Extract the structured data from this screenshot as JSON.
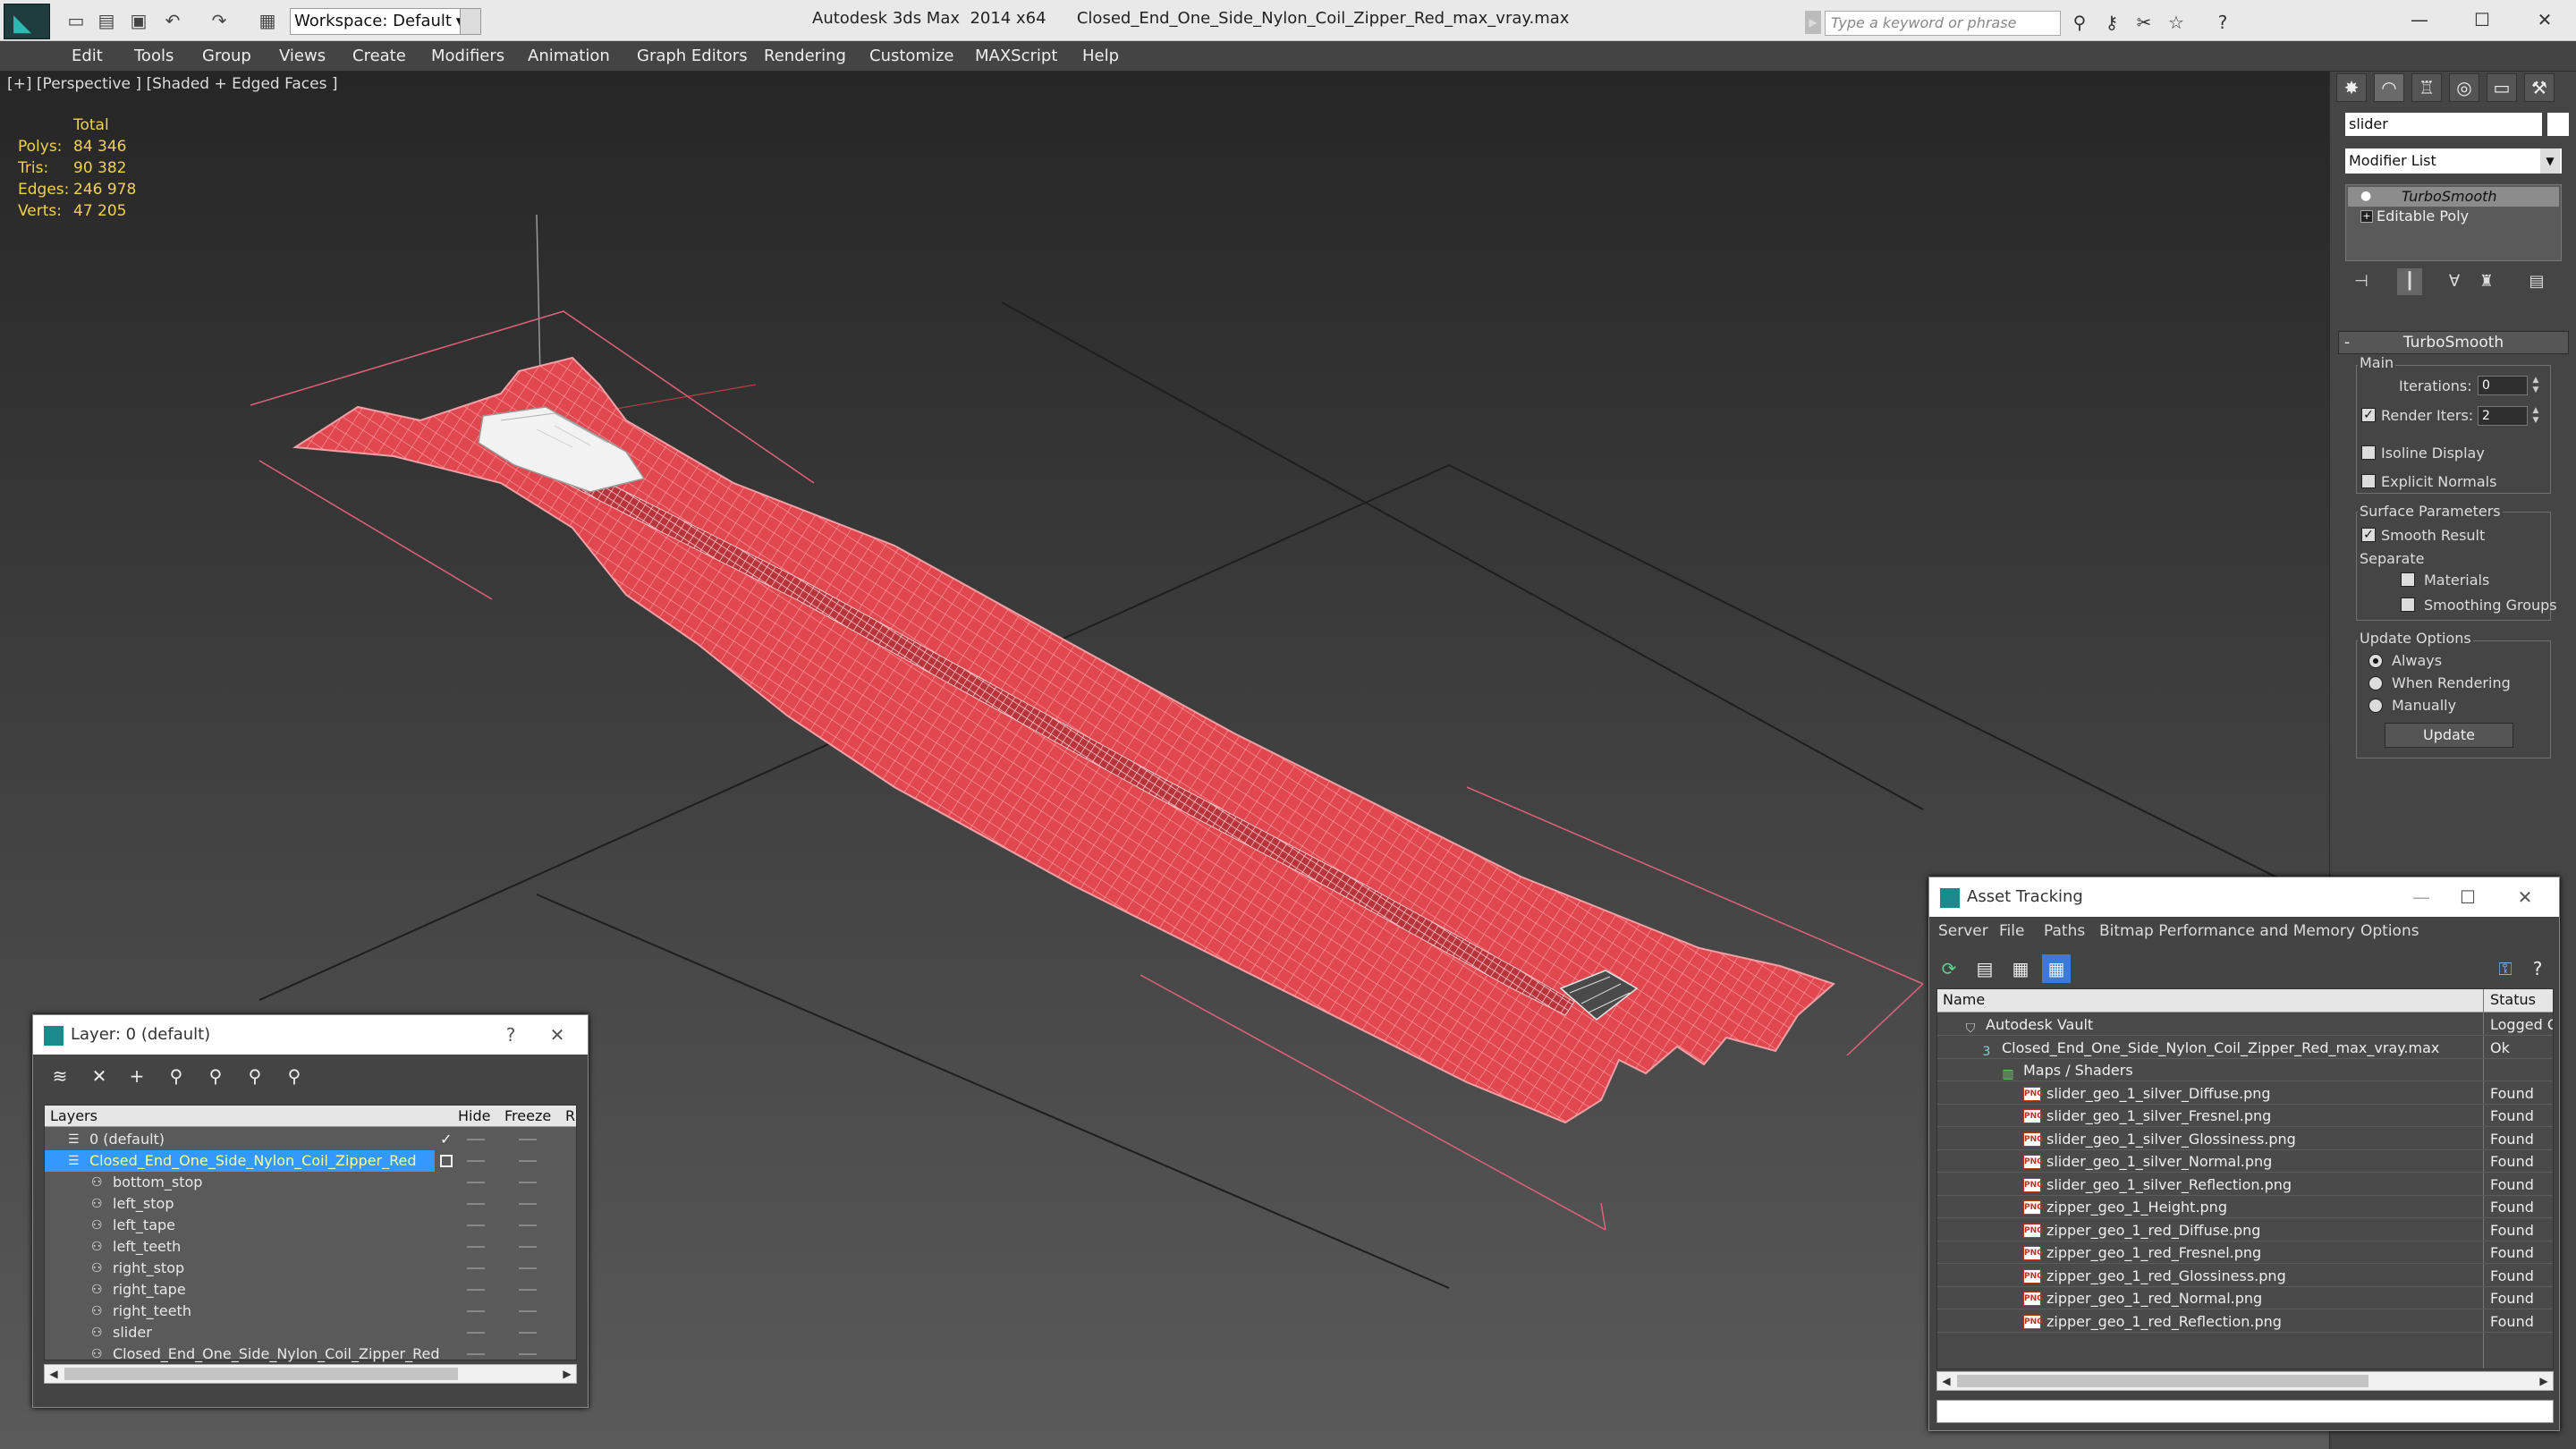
{
  "titlebar": {
    "workspace": "Workspace: Default",
    "app_title": "Autodesk 3ds Max  2014 x64      Closed_End_One_Side_Nylon_Coil_Zipper_Red_max_vray.max",
    "search_placeholder": "Type a keyword or phrase"
  },
  "menu": [
    "Edit",
    "Tools",
    "Group",
    "Views",
    "Create",
    "Modifiers",
    "Animation",
    "Graph Editors",
    "Rendering",
    "Customize",
    "MAXScript",
    "Help"
  ],
  "viewport": {
    "label": "[+] [Perspective ] [Shaded + Edged Faces ]",
    "stats_header": "Total",
    "stats": [
      {
        "label": "Polys:",
        "value": "84 346"
      },
      {
        "label": "Tris:",
        "value": "90 382"
      },
      {
        "label": "Edges:",
        "value": "246 978"
      },
      {
        "label": "Verts:",
        "value": "47 205"
      }
    ]
  },
  "command_panel": {
    "object_name": "slider",
    "modifier_list": "Modifier List",
    "stack": [
      "TurboSmooth",
      "Editable Poly"
    ],
    "rollout_title": "TurboSmooth",
    "main_label": "Main",
    "iterations_label": "Iterations:",
    "iterations_value": "0",
    "render_iters_label": "Render Iters:",
    "render_iters_value": "2",
    "isoline_label": "Isoline Display",
    "explicit_label": "Explicit Normals",
    "surface_label": "Surface Parameters",
    "smooth_label": "Smooth Result",
    "separate_label": "Separate",
    "materials_label": "Materials",
    "smoothing_label": "Smoothing Groups",
    "update_options_label": "Update Options",
    "always_label": "Always",
    "when_rendering_label": "When Rendering",
    "manually_label": "Manually",
    "update_button": "Update"
  },
  "layer_dialog": {
    "title": "Layer: 0 (default)",
    "help": "?",
    "columns": [
      "Layers",
      "Hide",
      "Freeze",
      "R"
    ],
    "rows": [
      {
        "name": "0 (default)",
        "indent": 0
      },
      {
        "name": "Closed_End_One_Side_Nylon_Coil_Zipper_Red",
        "indent": 0
      },
      {
        "name": "bottom_stop",
        "indent": 1
      },
      {
        "name": "left_stop",
        "indent": 1
      },
      {
        "name": "left_tape",
        "indent": 1
      },
      {
        "name": "left_teeth",
        "indent": 1
      },
      {
        "name": "right_stop",
        "indent": 1
      },
      {
        "name": "right_tape",
        "indent": 1
      },
      {
        "name": "right_teeth",
        "indent": 1
      },
      {
        "name": "slider",
        "indent": 1
      },
      {
        "name": "Closed_End_One_Side_Nylon_Coil_Zipper_Red",
        "indent": 1
      }
    ]
  },
  "asset_dialog": {
    "title": "Asset Tracking",
    "menu": [
      "Server",
      "File",
      "Paths",
      "Bitmap Performance and Memory",
      "Options"
    ],
    "columns": [
      "Name",
      "Status"
    ],
    "rows": [
      {
        "name": "Autodesk Vault",
        "status": "Logged Ou",
        "level": 0,
        "kind": "vault"
      },
      {
        "name": "Closed_End_One_Side_Nylon_Coil_Zipper_Red_max_vray.max",
        "status": "Ok",
        "level": 1,
        "kind": "max"
      },
      {
        "name": "Maps / Shaders",
        "status": "",
        "level": 2,
        "kind": "maps"
      },
      {
        "name": "slider_geo_1_silver_Diffuse.png",
        "status": "Found",
        "level": 3,
        "kind": "png"
      },
      {
        "name": "slider_geo_1_silver_Fresnel.png",
        "status": "Found",
        "level": 3,
        "kind": "png"
      },
      {
        "name": "slider_geo_1_silver_Glossiness.png",
        "status": "Found",
        "level": 3,
        "kind": "png"
      },
      {
        "name": "slider_geo_1_silver_Normal.png",
        "status": "Found",
        "level": 3,
        "kind": "png"
      },
      {
        "name": "slider_geo_1_silver_Reflection.png",
        "status": "Found",
        "level": 3,
        "kind": "png"
      },
      {
        "name": "zipper_geo_1_Height.png",
        "status": "Found",
        "level": 3,
        "kind": "png"
      },
      {
        "name": "zipper_geo_1_red_Diffuse.png",
        "status": "Found",
        "level": 3,
        "kind": "png"
      },
      {
        "name": "zipper_geo_1_red_Fresnel.png",
        "status": "Found",
        "level": 3,
        "kind": "png"
      },
      {
        "name": "zipper_geo_1_red_Glossiness.png",
        "status": "Found",
        "level": 3,
        "kind": "png"
      },
      {
        "name": "zipper_geo_1_red_Normal.png",
        "status": "Found",
        "level": 3,
        "kind": "png"
      },
      {
        "name": "zipper_geo_1_red_Reflection.png",
        "status": "Found",
        "level": 3,
        "kind": "png"
      }
    ]
  },
  "colors": {
    "accent_teal": "#1b8a8a",
    "stats_yellow": "#f0d24a",
    "zipper_red": "#e0474f",
    "selection_blue": "#3399ff"
  }
}
